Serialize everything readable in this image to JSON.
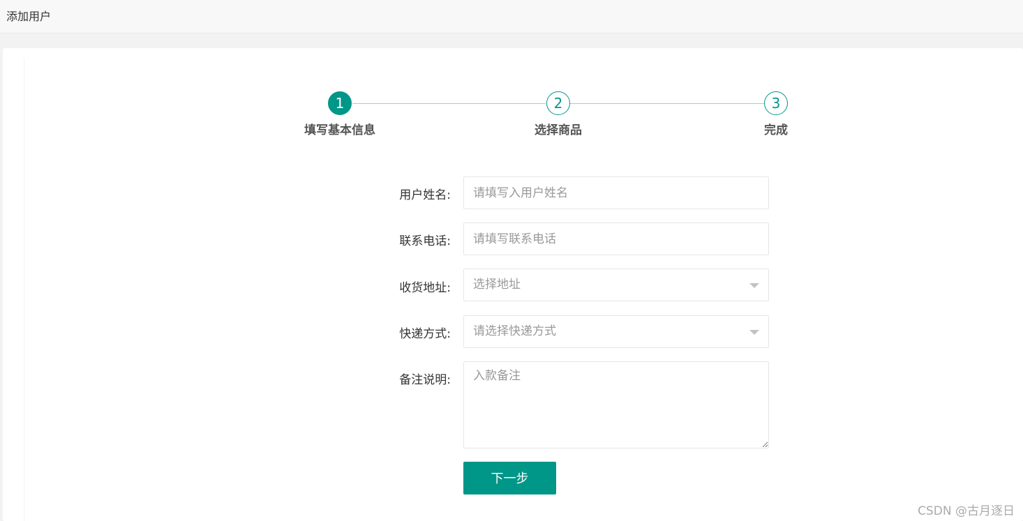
{
  "header": {
    "title": "添加用户"
  },
  "steps": [
    {
      "number": "1",
      "label": "填写基本信息",
      "state": "active"
    },
    {
      "number": "2",
      "label": "选择商品",
      "state": "pending"
    },
    {
      "number": "3",
      "label": "完成",
      "state": "pending"
    }
  ],
  "form": {
    "username": {
      "label": "用户姓名:",
      "placeholder": "请填写入用户姓名"
    },
    "phone": {
      "label": "联系电话:",
      "placeholder": "请填写联系电话"
    },
    "address": {
      "label": "收货地址:",
      "placeholder": "选择地址"
    },
    "shipping": {
      "label": "快递方式:",
      "placeholder": "请选择快递方式"
    },
    "note": {
      "label": "备注说明:",
      "placeholder": "入款备注"
    },
    "next_label": "下一步"
  },
  "watermark": "CSDN @古月逐日",
  "colors": {
    "accent": "#009688",
    "step_line": "#c2c2c2"
  }
}
